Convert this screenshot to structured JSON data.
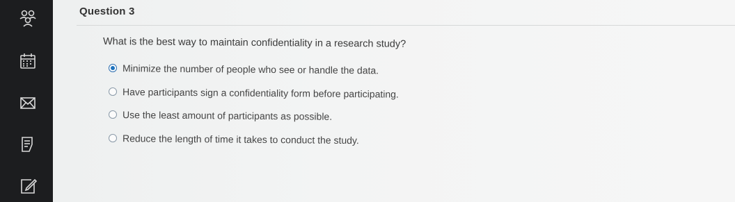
{
  "sidebar": {
    "items": [
      {
        "icon": "people-icon"
      },
      {
        "icon": "calendar-icon"
      },
      {
        "icon": "mail-icon"
      },
      {
        "icon": "gradebook-icon"
      },
      {
        "icon": "edit-icon"
      }
    ]
  },
  "question": {
    "title": "Question 3",
    "text": "What is the best way to maintain confidentiality in a research study?",
    "options": [
      {
        "label": "Minimize the number of people who see or handle the data.",
        "selected": true
      },
      {
        "label": "Have participants sign a confidentiality form before participating.",
        "selected": false
      },
      {
        "label": "Use the least amount of participants as possible.",
        "selected": false
      },
      {
        "label": "Reduce the length of time it takes to conduct the study.",
        "selected": false
      }
    ]
  },
  "colors": {
    "sidebar_bg": "#1c1d1f",
    "selected_radio": "#1e73be"
  }
}
